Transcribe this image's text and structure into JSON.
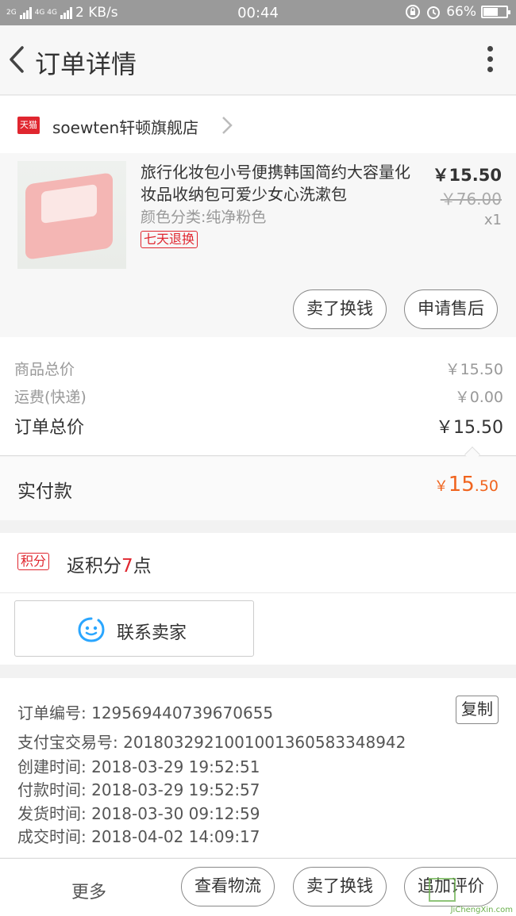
{
  "status_bar": {
    "network_1": "2G",
    "network_2": "4G 4G",
    "speed": "2 KB/s",
    "time": "00:44",
    "battery": "66%",
    "battery_level": 0.66
  },
  "header": {
    "title": "订单详情"
  },
  "shop": {
    "badge": "天猫",
    "name": "soewten轩顿旗舰店"
  },
  "product": {
    "title": "旅行化妆包小号便携韩国简约大容量化妆品收纳包可爱少女心洗漱包",
    "spec": "颜色分类:纯净粉色",
    "tag": "七天退换",
    "price": "￥15.50",
    "original_price": "￥76.00",
    "quantity": "x1",
    "sell_button": "卖了换钱",
    "aftersale_button": "申请售后"
  },
  "summary": {
    "goods_label": "商品总价",
    "goods_value": "￥15.50",
    "shipping_label": "运费(快递)",
    "shipping_value": "￥0.00",
    "total_label": "订单总价",
    "total_value": "￥15.50"
  },
  "paid": {
    "label": "实付款",
    "symbol": "￥",
    "integer": "15",
    "decimal": ".50"
  },
  "points": {
    "badge": "积分",
    "prefix": "返积分",
    "number": "7",
    "suffix": "点"
  },
  "contact": {
    "label": "联系卖家"
  },
  "order_info": {
    "order_no": "订单编号: 129569440739670655",
    "alipay_no": "支付宝交易号: 2018032921001001360583348942",
    "created": "创建时间: 2018-03-29 19:52:51",
    "paid": "付款时间: 2018-03-29 19:52:57",
    "shipped": "发货时间: 2018-03-30 09:12:59",
    "completed": "成交时间: 2018-04-02 14:09:17",
    "copy_button": "复制"
  },
  "footer": {
    "more": "更多",
    "logistics_button": "查看物流",
    "sell_button": "卖了换钱",
    "review_button": "追加评价"
  },
  "watermark": "JiChengXin.com",
  "colors": {
    "accent_red": "#e0262f",
    "price_orange": "#f0641e",
    "contact_blue": "#2aa6ff"
  }
}
